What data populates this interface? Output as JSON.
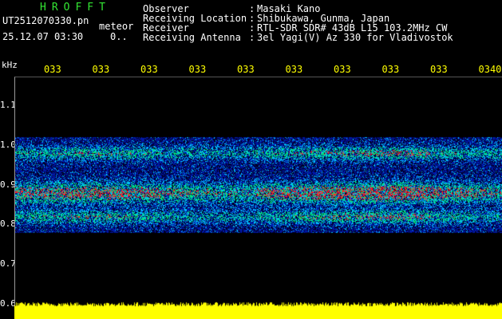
{
  "app": {
    "title": "HROFFT"
  },
  "file": {
    "name": "UT2512070330.pn",
    "type": "meteor",
    "datetime": "25.12.07 03:30",
    "count": "0.."
  },
  "header": {
    "rows": [
      {
        "label": "Observer",
        "value": "Masaki Kano"
      },
      {
        "label": "Receiving Location",
        "value": "Shibukawa, Gunma, Japan"
      },
      {
        "label": "Receiver",
        "value": "RTL-SDR SDR# 43dB L15 103.2MHz CW"
      },
      {
        "label": "Receiving Antenna",
        "value": "3el Yagi(V) Az 330 for Vladivostok"
      }
    ]
  },
  "chart_data": {
    "type": "heatmap",
    "ylabel": "kHz",
    "x_tick_labels": [
      "033",
      "033",
      "033",
      "033",
      "033",
      "033",
      "033",
      "033",
      "033",
      "0340"
    ],
    "y_ticks": [
      1.1,
      1.0,
      0.9,
      0.8,
      0.7,
      0.6
    ],
    "y_tick_labels": [
      "1.1",
      "1.0",
      "0.9",
      "0.8",
      "0.7",
      "0.6"
    ],
    "ylim": [
      0.6,
      1.1
    ],
    "bands": [
      {
        "center_khz": 0.98,
        "intensity": "medium"
      },
      {
        "center_khz": 0.88,
        "intensity": "high"
      },
      {
        "center_khz": 0.82,
        "intensity": "medium"
      }
    ],
    "colors": {
      "background": "#000000",
      "low": "#0018a8",
      "mid": "#00c0ff",
      "high": "#ff2020",
      "level": "#ffff00"
    }
  }
}
